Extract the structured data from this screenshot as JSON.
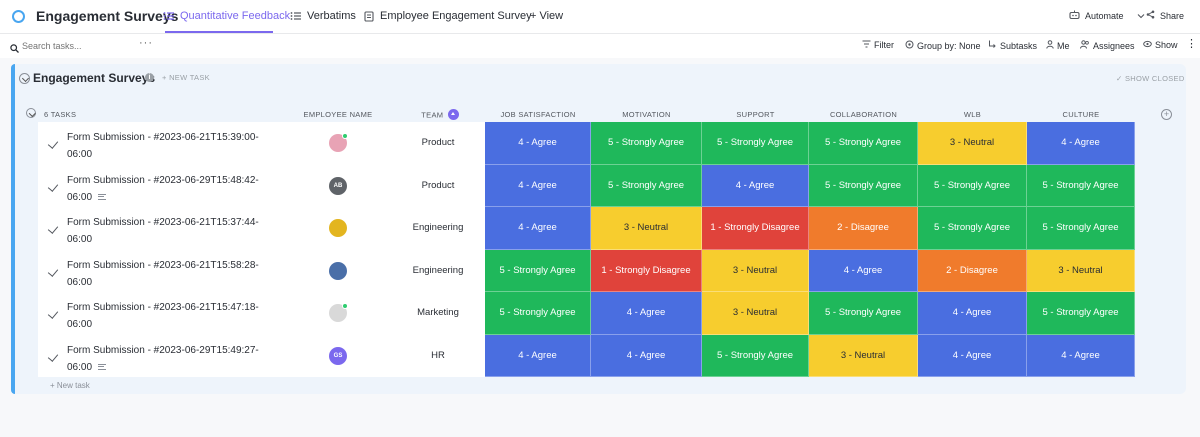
{
  "window": {
    "title": "Engagement Surveys"
  },
  "tabs": [
    {
      "label": "Quantitative Feedback",
      "active": true
    },
    {
      "label": "Verbatims",
      "active": false
    },
    {
      "label": "Employee Engagement Survey",
      "active": false
    }
  ],
  "add_view_label": "+ View",
  "top_actions": {
    "automate_label": "Automate",
    "share_label": "Share"
  },
  "toolbar": {
    "search_placeholder": "Search tasks...",
    "filter_label": "Filter",
    "group_by_label": "Group by: None",
    "subtasks_label": "Subtasks",
    "me_label": "Me",
    "assignees_label": "Assignees",
    "show_label": "Show"
  },
  "group": {
    "title": "Engagement Surveys",
    "new_task_label": "+ NEW TASK",
    "show_closed_label": "SHOW CLOSED",
    "task_count": "6 TASKS",
    "bottom_new_task_label": "+ New task"
  },
  "columns": {
    "employee": "EMPLOYEE NAME",
    "team": "TEAM",
    "ratings": [
      "JOB SATISFACTION",
      "MOTIVATION",
      "SUPPORT",
      "COLLABORATION",
      "WLB",
      "CULTURE"
    ]
  },
  "rating_colors": {
    "4 - Agree": {
      "bg": "#4a6ee0",
      "dark": false
    },
    "5 - Strongly Agree": {
      "bg": "#1fb85b",
      "dark": false
    },
    "3 - Neutral": {
      "bg": "#f7cd2e",
      "dark": true
    },
    "2 - Disagree": {
      "bg": "#f07b2c",
      "dark": false
    },
    "1 - Strongly Disagree": {
      "bg": "#e0433b",
      "dark": false
    }
  },
  "rows": [
    {
      "name_line1": "Form Submission - #2023-06-21T15:39:00-",
      "name_line2": "06:00",
      "has_description": false,
      "avatar": {
        "initials": "",
        "color": "#e8a3b5",
        "online": true
      },
      "team": "Product",
      "ratings": [
        "4 - Agree",
        "5 - Strongly Agree",
        "5 - Strongly Agree",
        "5 - Strongly Agree",
        "3 - Neutral",
        "4 - Agree"
      ]
    },
    {
      "name_line1": "Form Submission - #2023-06-29T15:48:42-",
      "name_line2": "06:00",
      "has_description": true,
      "avatar": {
        "initials": "AB",
        "color": "#5f6368",
        "online": false
      },
      "team": "Product",
      "ratings": [
        "4 - Agree",
        "5 - Strongly Agree",
        "4 - Agree",
        "5 - Strongly Agree",
        "5 - Strongly Agree",
        "5 - Strongly Agree"
      ]
    },
    {
      "name_line1": "Form Submission - #2023-06-21T15:37:44-",
      "name_line2": "06:00",
      "has_description": false,
      "avatar": {
        "initials": "",
        "color": "#e3b51f",
        "online": false
      },
      "team": "Engineering",
      "ratings": [
        "4 - Agree",
        "3 - Neutral",
        "1 - Strongly Disagree",
        "2 - Disagree",
        "5 - Strongly Agree",
        "5 - Strongly Agree"
      ]
    },
    {
      "name_line1": "Form Submission - #2023-06-21T15:58:28-",
      "name_line2": "06:00",
      "has_description": false,
      "avatar": {
        "initials": "",
        "color": "#4a6fa8",
        "online": false
      },
      "team": "Engineering",
      "ratings": [
        "5 - Strongly Agree",
        "1 - Strongly Disagree",
        "3 - Neutral",
        "4 - Agree",
        "2 - Disagree",
        "3 - Neutral"
      ]
    },
    {
      "name_line1": "Form Submission - #2023-06-21T15:47:18-",
      "name_line2": "06:00",
      "has_description": false,
      "avatar": {
        "initials": "",
        "color": "#d9d9d9",
        "online": true
      },
      "team": "Marketing",
      "ratings": [
        "5 - Strongly Agree",
        "4 - Agree",
        "3 - Neutral",
        "5 - Strongly Agree",
        "4 - Agree",
        "5 - Strongly Agree"
      ]
    },
    {
      "name_line1": "Form Submission - #2023-06-29T15:49:27-",
      "name_line2": "06:00",
      "has_description": true,
      "avatar": {
        "initials": "GS",
        "color": "#7b68ee",
        "online": false
      },
      "team": "HR",
      "ratings": [
        "4 - Agree",
        "4 - Agree",
        "5 - Strongly Agree",
        "3 - Neutral",
        "4 - Agree",
        "4 - Agree"
      ]
    }
  ]
}
